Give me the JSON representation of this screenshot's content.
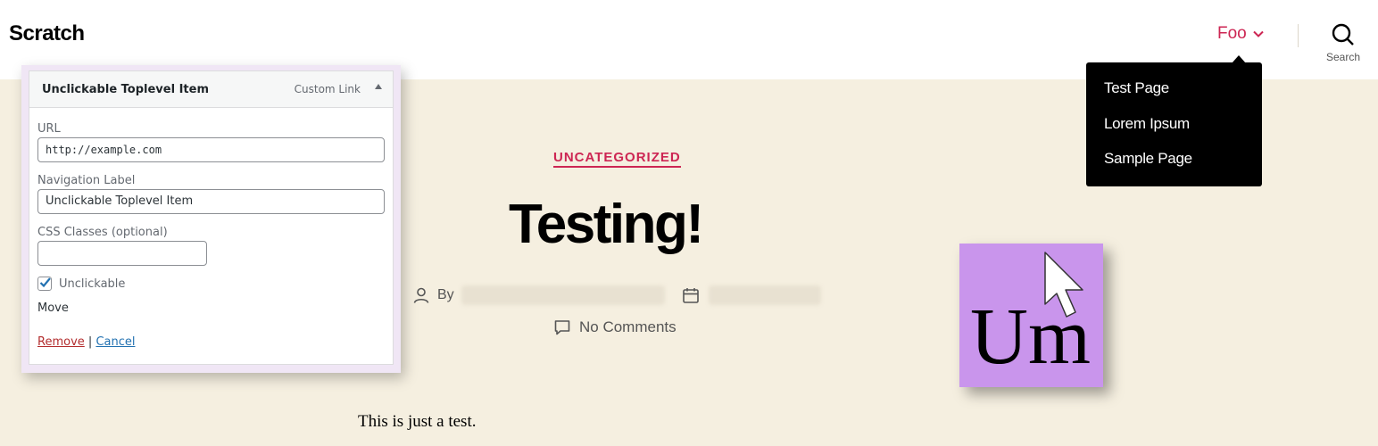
{
  "header": {
    "site_title": "Scratch",
    "nav_item": "Foo",
    "search_label": "Search",
    "accent_color": "#cd2653"
  },
  "submenu": {
    "items": [
      "Test Page",
      "Lorem Ipsum",
      "Sample Page"
    ]
  },
  "post": {
    "category": "UNCATEGORIZED",
    "title": "Testing!",
    "by_label": "By",
    "comments": "No Comments",
    "body": "This is just a test."
  },
  "logo": {
    "text": "Um",
    "background": "#c995ec",
    "icon": "cursor-icon"
  },
  "menu_item_panel": {
    "title": "Unclickable Toplevel Item",
    "type": "Custom Link",
    "url_label": "URL",
    "url_value": "http://example.com",
    "nav_label_label": "Navigation Label",
    "nav_label_value": "Unclickable Toplevel Item",
    "css_label": "CSS Classes (optional)",
    "css_value": "",
    "unclickable_label": "Unclickable",
    "unclickable_checked": true,
    "move_label": "Move",
    "remove": "Remove",
    "separator": "|",
    "cancel": "Cancel"
  }
}
